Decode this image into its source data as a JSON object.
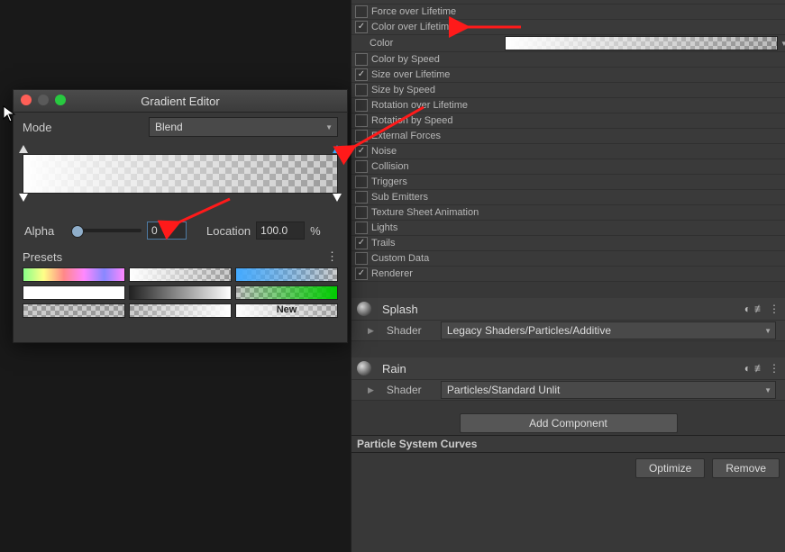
{
  "inspector": {
    "modules": [
      {
        "label": "Force over Lifetime",
        "checked": false
      },
      {
        "label": "Color over Lifetime",
        "checked": true
      },
      {
        "label": "Color by Speed",
        "checked": false
      },
      {
        "label": "Size over Lifetime",
        "checked": true
      },
      {
        "label": "Size by Speed",
        "checked": false
      },
      {
        "label": "Rotation over Lifetime",
        "checked": false
      },
      {
        "label": "Rotation by Speed",
        "checked": false
      },
      {
        "label": "External Forces",
        "checked": false
      },
      {
        "label": "Noise",
        "checked": true
      },
      {
        "label": "Collision",
        "checked": false
      },
      {
        "label": "Triggers",
        "checked": false
      },
      {
        "label": "Sub Emitters",
        "checked": false
      },
      {
        "label": "Texture Sheet Animation",
        "checked": false
      },
      {
        "label": "Lights",
        "checked": false
      },
      {
        "label": "Trails",
        "checked": true
      },
      {
        "label": "Custom Data",
        "checked": false
      },
      {
        "label": "Renderer",
        "checked": true
      }
    ],
    "color_label": "Color",
    "materials": [
      {
        "name": "Splash",
        "shader_label": "Shader",
        "shader_value": "Legacy Shaders/Particles/Additive"
      },
      {
        "name": "Rain",
        "shader_label": "Shader",
        "shader_value": "Particles/Standard Unlit"
      }
    ],
    "add_component": "Add Component",
    "curves_header": "Particle System Curves",
    "buttons": {
      "optimize": "Optimize",
      "remove": "Remove"
    }
  },
  "gradient_editor": {
    "title": "Gradient Editor",
    "mode_label": "Mode",
    "mode_value": "Blend",
    "alpha_label": "Alpha",
    "alpha_value": "0",
    "location_label": "Location",
    "location_value": "100.0",
    "location_unit": "%",
    "presets_label": "Presets",
    "new_label": "New"
  }
}
